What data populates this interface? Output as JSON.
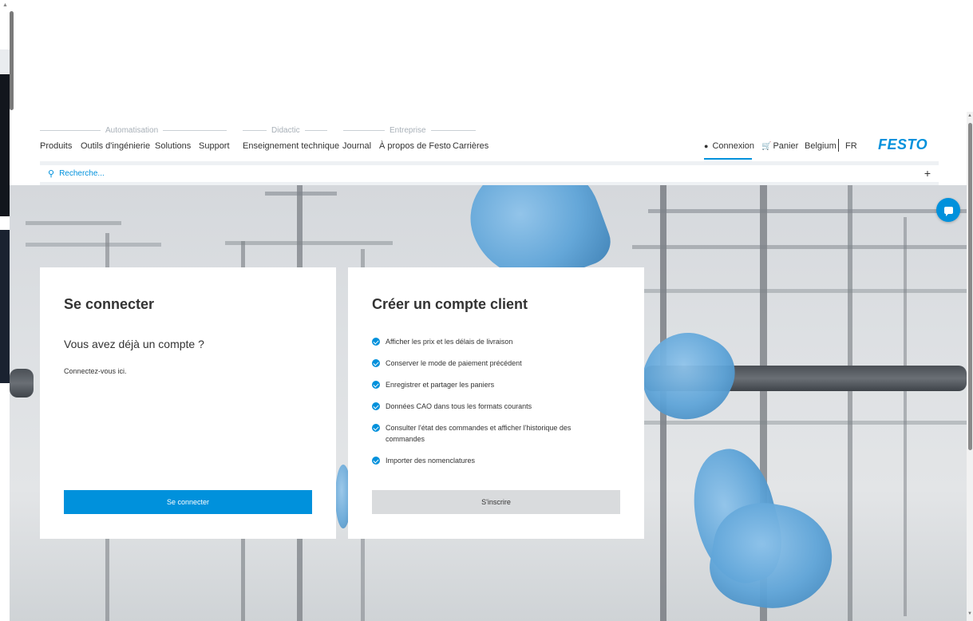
{
  "header": {
    "groups": [
      {
        "label": "Automatisation"
      },
      {
        "label": "Didactic"
      },
      {
        "label": "Entreprise"
      }
    ],
    "nav": [
      "Produits",
      "Outils d'ingénierie",
      "Solutions",
      "Support",
      "Enseignement technique",
      "Journal",
      "À propos de Festo",
      "Carrières"
    ],
    "connexion_label": "Connexion",
    "cart_label": "Panier",
    "country_label": "Belgium",
    "language_label": "FR",
    "logo_text": "FESTO"
  },
  "search": {
    "placeholder": "Recherche...",
    "expand_symbol": "+"
  },
  "login_card": {
    "title": "Se connecter",
    "subtitle": "Vous avez déjà un compte ?",
    "hint": "Connectez-vous ici.",
    "button_label": "Se connecter"
  },
  "register_card": {
    "title": "Créer un compte client",
    "features": [
      "Afficher les prix et les délais de livraison",
      "Conserver le mode de paiement précédent",
      "Enregistrer et partager les paniers",
      "Données CAO dans tous les formats courants",
      "Consulter l'état des commandes et afficher l'historique des commandes",
      "Importer des nomenclatures"
    ],
    "button_label": "S'inscrire"
  },
  "colors": {
    "accent": "#0091dc",
    "secondary_button": "#d9dbdd",
    "text": "#333333"
  }
}
